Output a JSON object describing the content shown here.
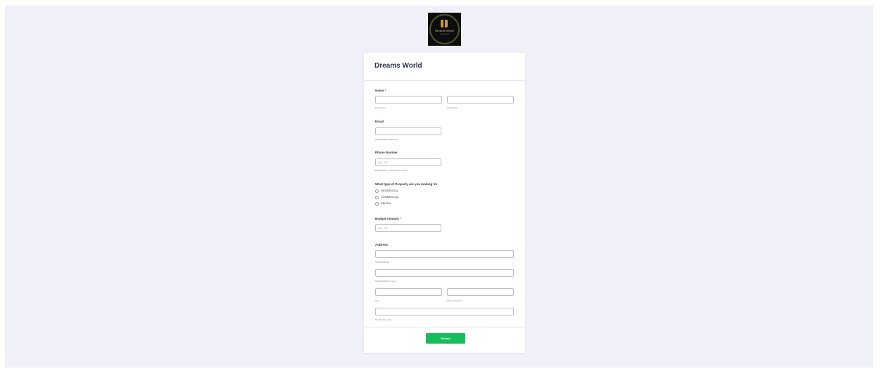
{
  "logo": {
    "text": "Dreams World",
    "subtext": "REAL ESTATE"
  },
  "form": {
    "title": "Dreams World",
    "required_mark": "*",
    "name": {
      "label": "Name",
      "first_sub": "First Name",
      "last_sub": "Last Name"
    },
    "email": {
      "label": "Email",
      "sub": "example@example.com"
    },
    "phone": {
      "label": "Phone Number",
      "placeholder": "e.g., 23",
      "sub": "Please enter a valid phone number."
    },
    "property": {
      "label": "What type of Property are you looking for",
      "options": [
        "RESIDENTIAL",
        "COMMERCIAL",
        "RENTAL"
      ]
    },
    "budget": {
      "label": "Budget Amount",
      "placeholder": "e.g., 23"
    },
    "address": {
      "label": "Address",
      "street_sub": "Street Address",
      "street2_sub": "Street Address Line 2",
      "city_sub": "City",
      "state_sub": "State / Province",
      "zip_sub": "Postal / Zip Code"
    },
    "submit_label": "Submit"
  },
  "colors": {
    "page_bg": "#f0f0f9",
    "accent": "#18bd5b",
    "required": "#f23a3c"
  }
}
